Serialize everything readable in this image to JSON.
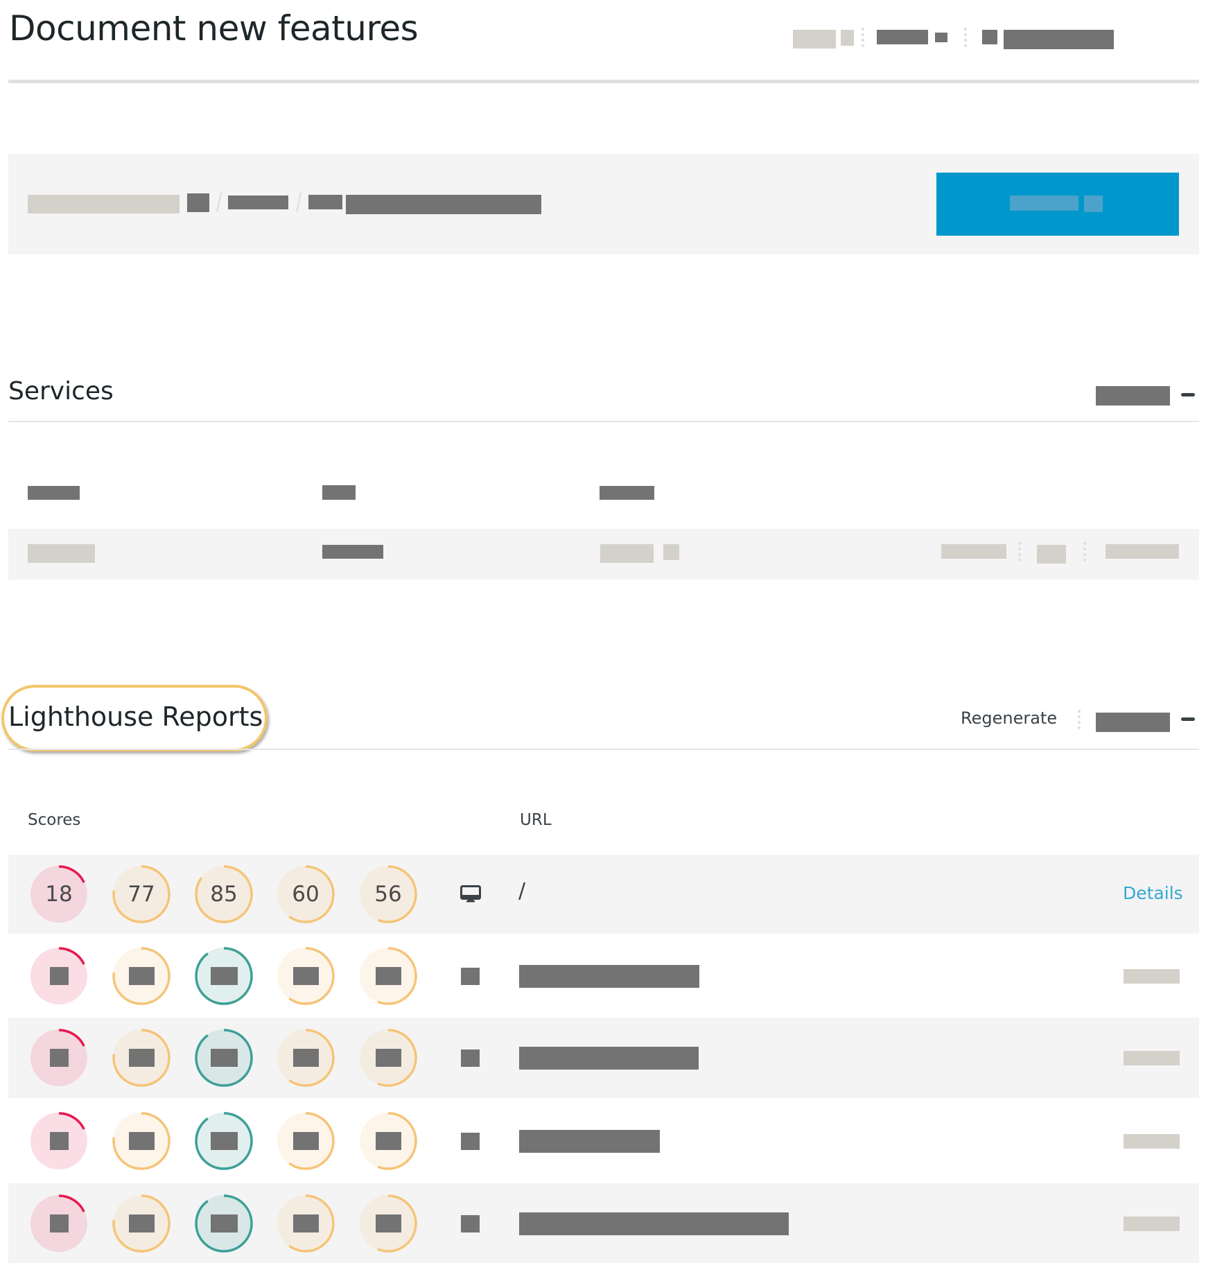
{
  "page": {
    "title": "Document new features"
  },
  "header_meta": {
    "items": [
      "[redacted]",
      "[redacted]",
      "[redacted]",
      "[redacted]",
      "[redacted]",
      "[redacted]"
    ]
  },
  "breadcrumb": {
    "items": [
      "[redacted]",
      "[redacted]",
      "[redacted]",
      "[redacted]"
    ],
    "primary_button": "[redacted]"
  },
  "services": {
    "title": "Services",
    "action": "[redacted]",
    "collapse_icon": "minus-icon",
    "columns": [
      "[redacted]",
      "[redacted]",
      "[redacted]"
    ],
    "rows": [
      {
        "cells": [
          "[redacted]",
          "[redacted]",
          "[redacted]"
        ],
        "actions": [
          "[redacted]",
          "[redacted]",
          "[redacted]"
        ]
      }
    ]
  },
  "lighthouse": {
    "title": "Lighthouse Reports",
    "regenerate_label": "Regenerate",
    "action": "[redacted]",
    "collapse_icon": "minus-icon",
    "columns": {
      "scores": "Scores",
      "url": "URL"
    },
    "colors": {
      "poor": "#e8194f",
      "average": "#f5c477",
      "good": "#3d9f98"
    },
    "rows": [
      {
        "scores": [
          18,
          77,
          85,
          60,
          56
        ],
        "device": "desktop-icon",
        "url": "/",
        "link": "Details"
      },
      {
        "scores": [
          18,
          77,
          90,
          60,
          56
        ],
        "device": "[redacted]",
        "url": "[redacted]",
        "link": "[redacted]"
      },
      {
        "scores": [
          18,
          77,
          90,
          60,
          56
        ],
        "device": "[redacted]",
        "url": "[redacted]",
        "link": "[redacted]"
      },
      {
        "scores": [
          18,
          77,
          90,
          60,
          56
        ],
        "device": "[redacted]",
        "url": "[redacted]",
        "link": "[redacted]"
      },
      {
        "scores": [
          18,
          77,
          90,
          60,
          56
        ],
        "device": "[redacted]",
        "url": "[redacted]",
        "link": "[redacted]"
      }
    ]
  }
}
